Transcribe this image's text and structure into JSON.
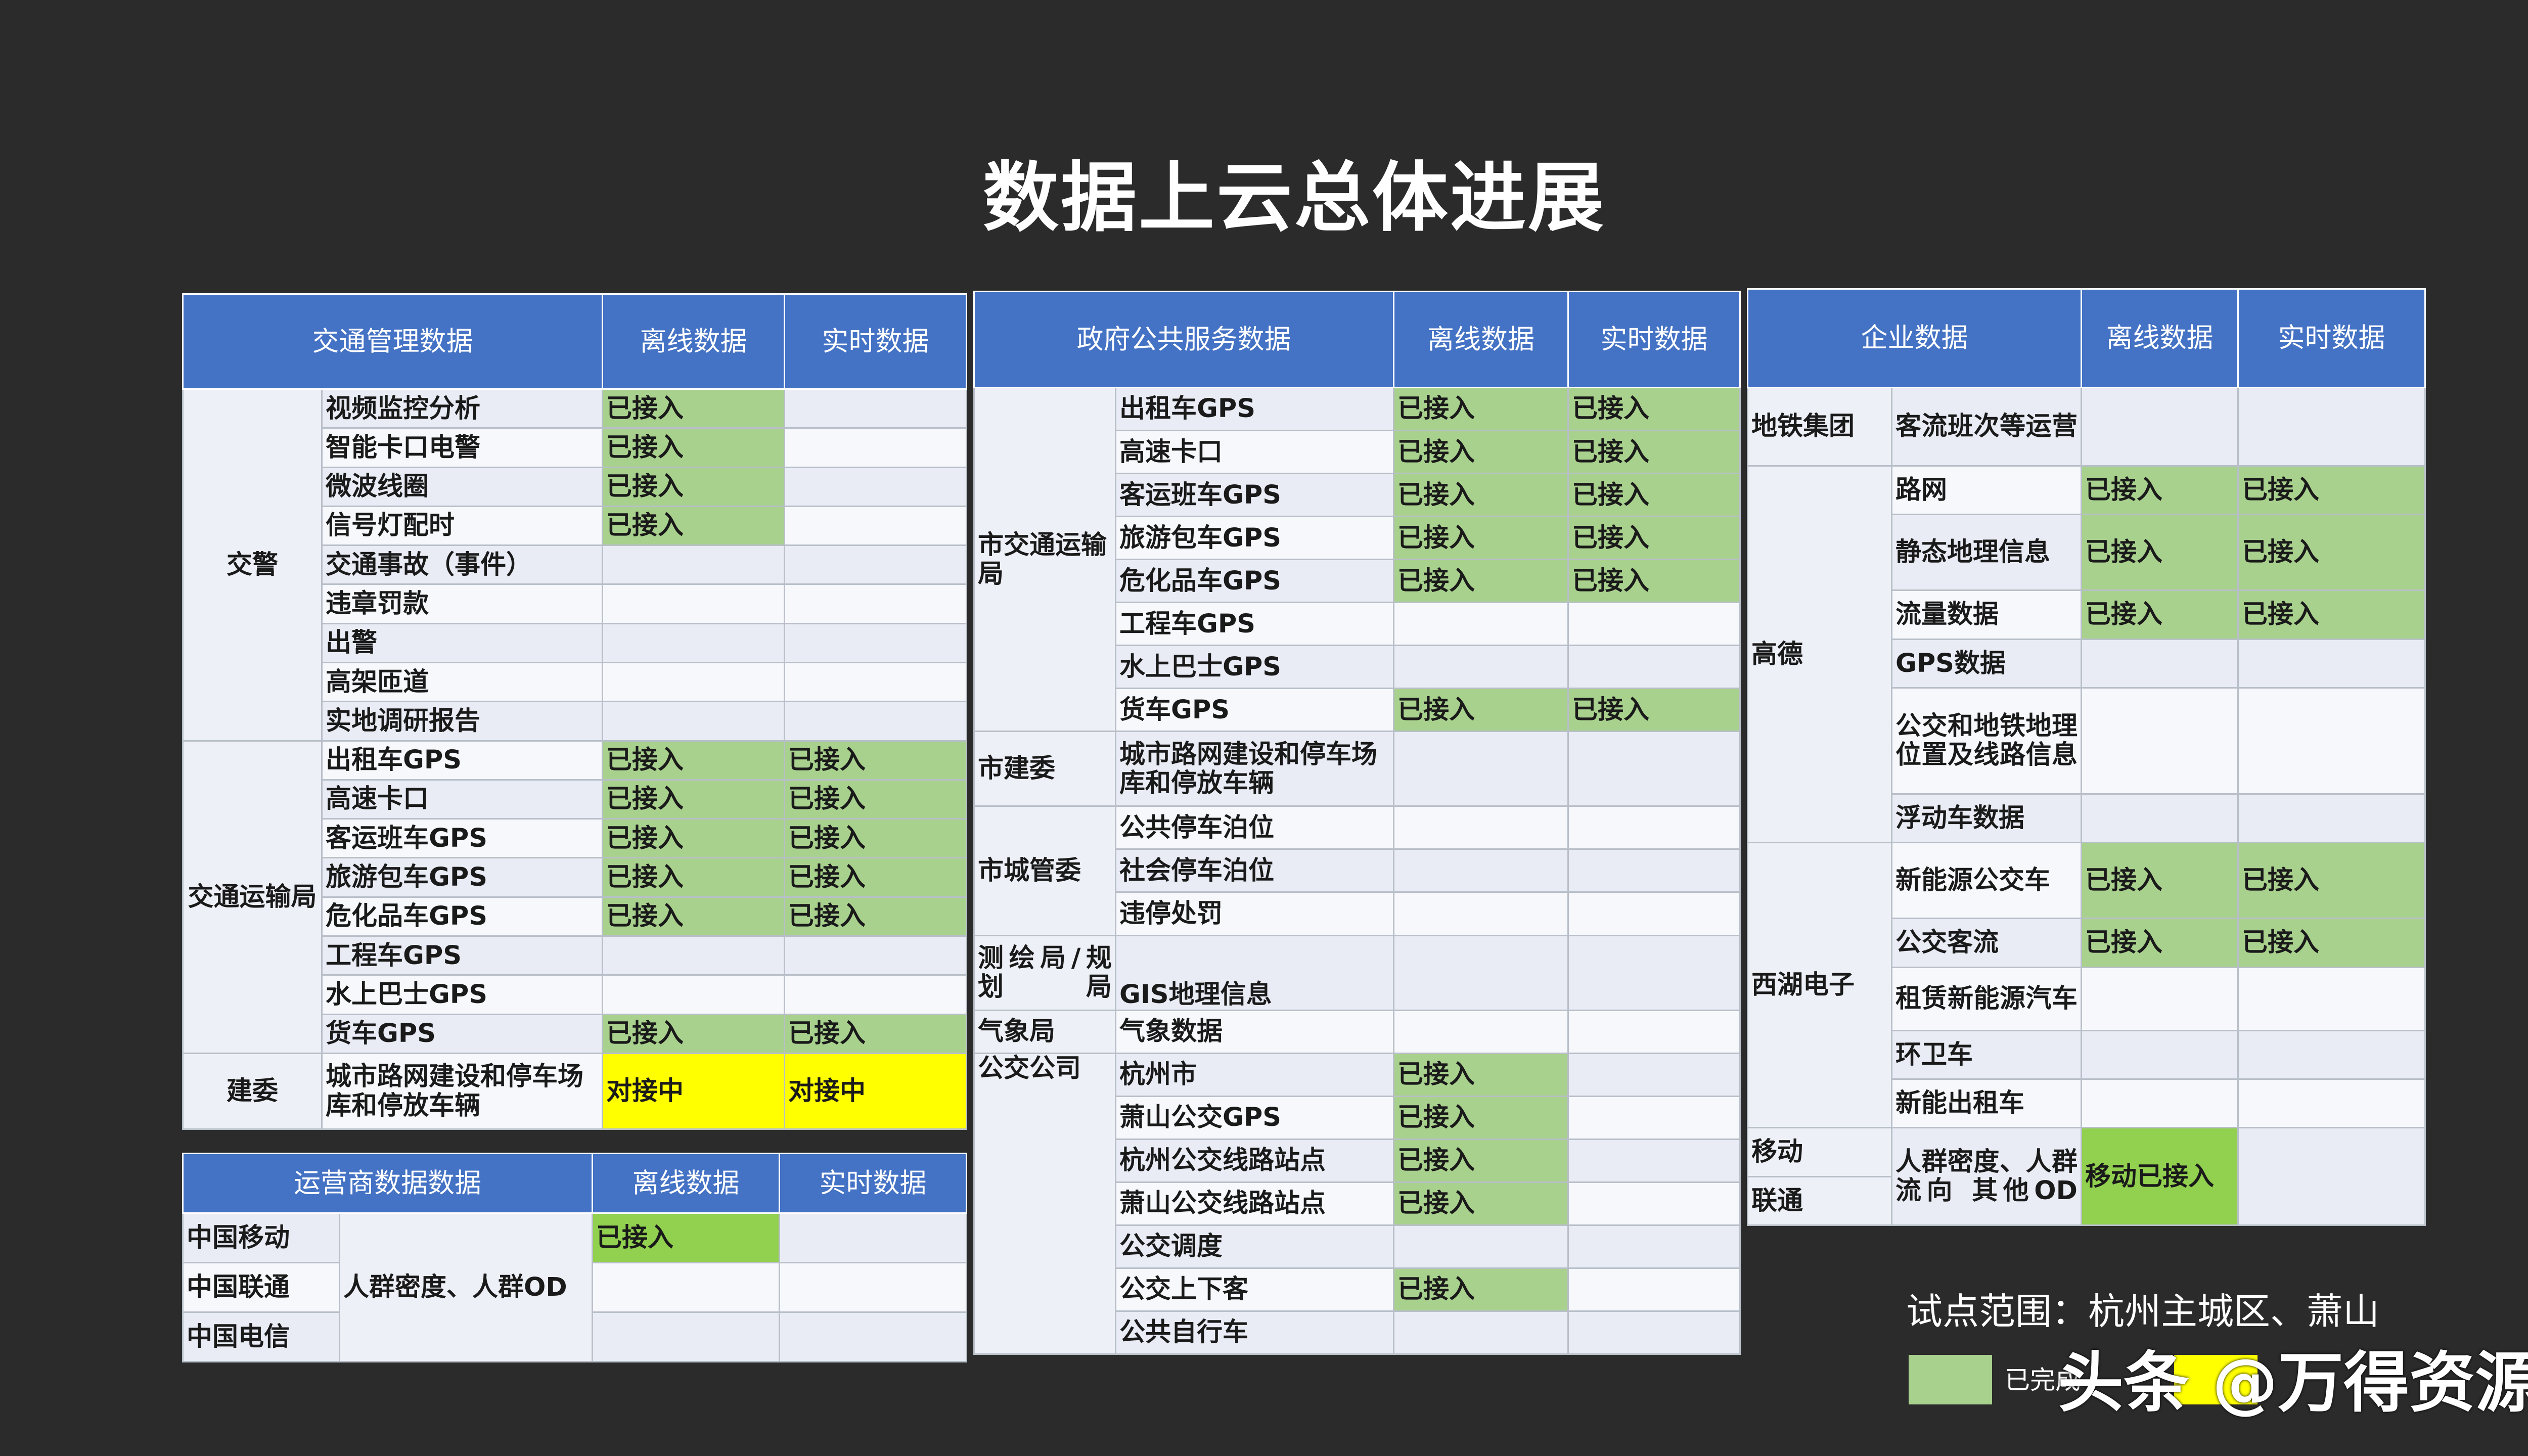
{
  "title": "数据上云总体进展",
  "status": {
    "done": "已接入",
    "pending": "对接中",
    "mobile_done": "移动已接入"
  },
  "colors": {
    "header": "#4472c4",
    "done": "#a9d18e",
    "mobile_done": "#92d050",
    "pending": "#ffff00",
    "background": "#2b2b2b"
  },
  "traffic": {
    "headers": [
      "交通管理数据",
      "离线数据",
      "实时数据"
    ],
    "groups": [
      "交警",
      "交通运输局",
      "建委"
    ],
    "rows": [
      "视频监控分析",
      "智能卡口电警",
      "微波线圈",
      "信号灯配时",
      "交通事故（事件）",
      "违章罚款",
      "出警",
      "高架匝道",
      "实地调研报告",
      "出租车GPS",
      "高速卡口",
      "客运班车GPS",
      "旅游包车GPS",
      "危化品车GPS",
      "工程车GPS",
      "水上巴士GPS",
      "货车GPS",
      "城市路网建设和停车场库和停放车辆"
    ]
  },
  "operator": {
    "headers": [
      "运营商数据数据",
      "离线数据",
      "实时数据"
    ],
    "carriers": [
      "中国移动",
      "中国联通",
      "中国电信"
    ],
    "item": "人群密度、人群OD"
  },
  "gov": {
    "headers": [
      "政府公共服务数据",
      "离线数据",
      "实时数据"
    ],
    "groups": [
      "市交通运输局",
      "市建委",
      "市城管委",
      "测绘局/规划局",
      "气象局",
      "公交公司"
    ],
    "rows": [
      "出租车GPS",
      "高速卡口",
      "客运班车GPS",
      "旅游包车GPS",
      "危化品车GPS",
      "工程车GPS",
      "水上巴士GPS",
      "货车GPS",
      "城市路网建设和停车场库和停放车辆",
      "公共停车泊位",
      "社会停车泊位",
      "违停处罚",
      "GIS地理信息",
      "气象数据",
      "杭州市",
      "萧山公交GPS",
      "杭州公交线路站点",
      "萧山公交线路站点",
      "公交调度",
      "公交上下客",
      "公共自行车"
    ]
  },
  "enterprise": {
    "headers": [
      "企业数据",
      "离线数据",
      "实时数据"
    ],
    "groups": [
      "地铁集团",
      "高德",
      "西湖电子",
      "移动",
      "联通"
    ],
    "rows": [
      "客流班次等运营",
      "路网",
      "静态地理信息",
      "流量数据",
      "GPS数据",
      "公交和地铁地理位置及线路信息",
      "浮动车数据",
      "新能源公交车",
      "公交客流",
      "租赁新能源汽车",
      "环卫车",
      "新能出租车",
      "人群密度、人群流向 其他OD"
    ]
  },
  "legend": {
    "scope": "试点范围：杭州主城区、萧山",
    "done_label": "已完成"
  },
  "watermark": "头条 @万得资源"
}
